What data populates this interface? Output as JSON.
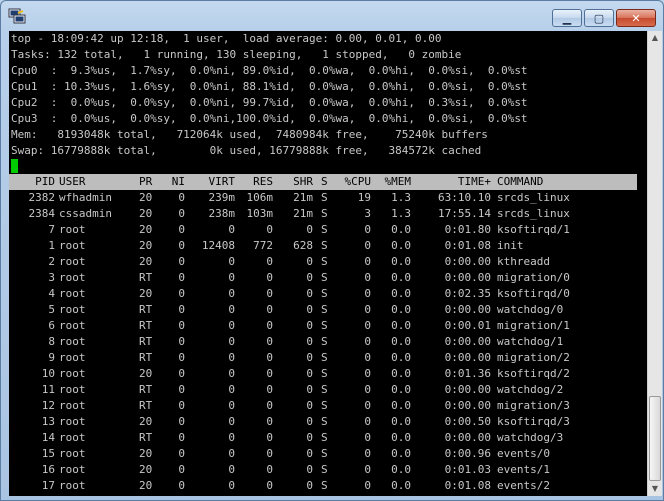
{
  "summary": {
    "uptime_line": "top - 18:09:42 up 12:18,  1 user,  load average: 0.00, 0.01, 0.00",
    "tasks_line": "Tasks: 132 total,   1 running, 130 sleeping,   1 stopped,   0 zombie",
    "cpu_lines": [
      "Cpu0  :  9.3%us,  1.7%sy,  0.0%ni, 89.0%id,  0.0%wa,  0.0%hi,  0.0%si,  0.0%st",
      "Cpu1  : 10.3%us,  1.6%sy,  0.0%ni, 88.1%id,  0.0%wa,  0.0%hi,  0.0%si,  0.0%st",
      "Cpu2  :  0.0%us,  0.0%sy,  0.0%ni, 99.7%id,  0.0%wa,  0.0%hi,  0.3%si,  0.0%st",
      "Cpu3  :  0.0%us,  0.0%sy,  0.0%ni,100.0%id,  0.0%wa,  0.0%hi,  0.0%si,  0.0%st"
    ],
    "mem_line": "Mem:   8193048k total,   712064k used,  7480984k free,    75240k buffers",
    "swap_line": "Swap: 16779888k total,        0k used, 16779888k free,   384572k cached"
  },
  "table": {
    "columns": [
      "PID",
      "USER",
      "PR",
      "NI",
      "VIRT",
      "RES",
      "SHR",
      "S",
      "%CPU",
      "%MEM",
      "TIME+",
      "COMMAND"
    ],
    "rows": [
      [
        "2382",
        "wfhadmin",
        "20",
        "0",
        "239m",
        "106m",
        "21m",
        "S",
        "19",
        "1.3",
        "63:10.10",
        "srcds_linux"
      ],
      [
        "2384",
        "cssadmin",
        "20",
        "0",
        "238m",
        "103m",
        "21m",
        "S",
        "3",
        "1.3",
        "17:55.14",
        "srcds_linux"
      ],
      [
        "7",
        "root",
        "20",
        "0",
        "0",
        "0",
        "0",
        "S",
        "0",
        "0.0",
        "0:01.80",
        "ksoftirqd/1"
      ],
      [
        "1",
        "root",
        "20",
        "0",
        "12408",
        "772",
        "628",
        "S",
        "0",
        "0.0",
        "0:01.08",
        "init"
      ],
      [
        "2",
        "root",
        "20",
        "0",
        "0",
        "0",
        "0",
        "S",
        "0",
        "0.0",
        "0:00.00",
        "kthreadd"
      ],
      [
        "3",
        "root",
        "RT",
        "0",
        "0",
        "0",
        "0",
        "S",
        "0",
        "0.0",
        "0:00.00",
        "migration/0"
      ],
      [
        "4",
        "root",
        "20",
        "0",
        "0",
        "0",
        "0",
        "S",
        "0",
        "0.0",
        "0:02.35",
        "ksoftirqd/0"
      ],
      [
        "5",
        "root",
        "RT",
        "0",
        "0",
        "0",
        "0",
        "S",
        "0",
        "0.0",
        "0:00.00",
        "watchdog/0"
      ],
      [
        "6",
        "root",
        "RT",
        "0",
        "0",
        "0",
        "0",
        "S",
        "0",
        "0.0",
        "0:00.01",
        "migration/1"
      ],
      [
        "8",
        "root",
        "RT",
        "0",
        "0",
        "0",
        "0",
        "S",
        "0",
        "0.0",
        "0:00.00",
        "watchdog/1"
      ],
      [
        "9",
        "root",
        "RT",
        "0",
        "0",
        "0",
        "0",
        "S",
        "0",
        "0.0",
        "0:00.00",
        "migration/2"
      ],
      [
        "10",
        "root",
        "20",
        "0",
        "0",
        "0",
        "0",
        "S",
        "0",
        "0.0",
        "0:01.36",
        "ksoftirqd/2"
      ],
      [
        "11",
        "root",
        "RT",
        "0",
        "0",
        "0",
        "0",
        "S",
        "0",
        "0.0",
        "0:00.00",
        "watchdog/2"
      ],
      [
        "12",
        "root",
        "RT",
        "0",
        "0",
        "0",
        "0",
        "S",
        "0",
        "0.0",
        "0:00.00",
        "migration/3"
      ],
      [
        "13",
        "root",
        "20",
        "0",
        "0",
        "0",
        "0",
        "S",
        "0",
        "0.0",
        "0:00.50",
        "ksoftirqd/3"
      ],
      [
        "14",
        "root",
        "RT",
        "0",
        "0",
        "0",
        "0",
        "S",
        "0",
        "0.0",
        "0:00.00",
        "watchdog/3"
      ],
      [
        "15",
        "root",
        "20",
        "0",
        "0",
        "0",
        "0",
        "S",
        "0",
        "0.0",
        "0:00.96",
        "events/0"
      ],
      [
        "16",
        "root",
        "20",
        "0",
        "0",
        "0",
        "0",
        "S",
        "0",
        "0.0",
        "0:01.03",
        "events/1"
      ],
      [
        "17",
        "root",
        "20",
        "0",
        "0",
        "0",
        "0",
        "S",
        "0",
        "0.0",
        "0:01.08",
        "events/2"
      ]
    ]
  },
  "window_controls": {
    "minimize": "▁",
    "maximize": "▢",
    "close": "✕"
  },
  "colors": {
    "terminal_bg": "#000000",
    "terminal_fg": "#c8c8c8",
    "header_bg": "#bdbdbd",
    "cursor": "#00cc00"
  }
}
